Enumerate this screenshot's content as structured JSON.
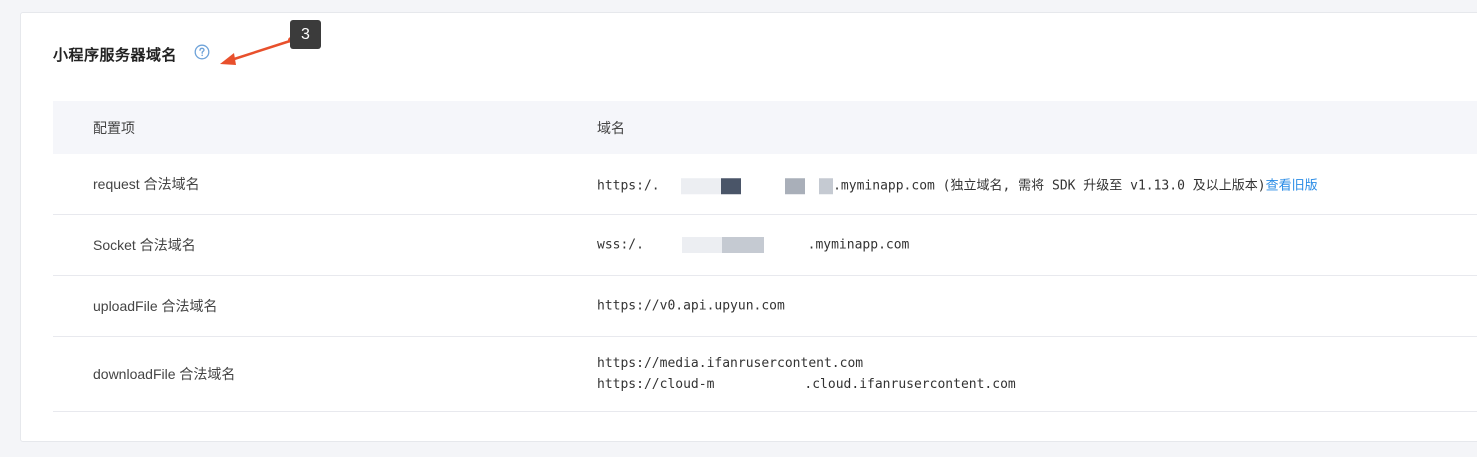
{
  "section": {
    "title": "小程序服务器域名",
    "help_icon": "question-circle-icon",
    "annotation_badge": "3"
  },
  "table": {
    "headers": {
      "config": "配置项",
      "domain": "域名"
    },
    "rows": [
      {
        "label": "request 合法域名",
        "domain_prefix": "https:/.",
        "domain_suffix": ".myminapp.com (独立域名, 需将 SDK 升级至 v1.13.0 及以上版本)",
        "link": "查看旧版"
      },
      {
        "label": "Socket 合法域名",
        "domain_prefix": "wss:/.",
        "domain_suffix": ".myminapp.com"
      },
      {
        "label": "uploadFile 合法域名",
        "domain": "https://v0.api.upyun.com"
      },
      {
        "label": "downloadFile 合法域名",
        "domain_line1": "https://media.ifanrusercontent.com",
        "domain_line2_prefix": "https://cloud-m",
        "domain_line2_suffix": ".cloud.ifanrusercontent.com"
      }
    ]
  },
  "colors": {
    "accent_link": "#2a8ce6",
    "annotation_arrow": "#e8502c",
    "header_bg": "#f5f6fa"
  }
}
